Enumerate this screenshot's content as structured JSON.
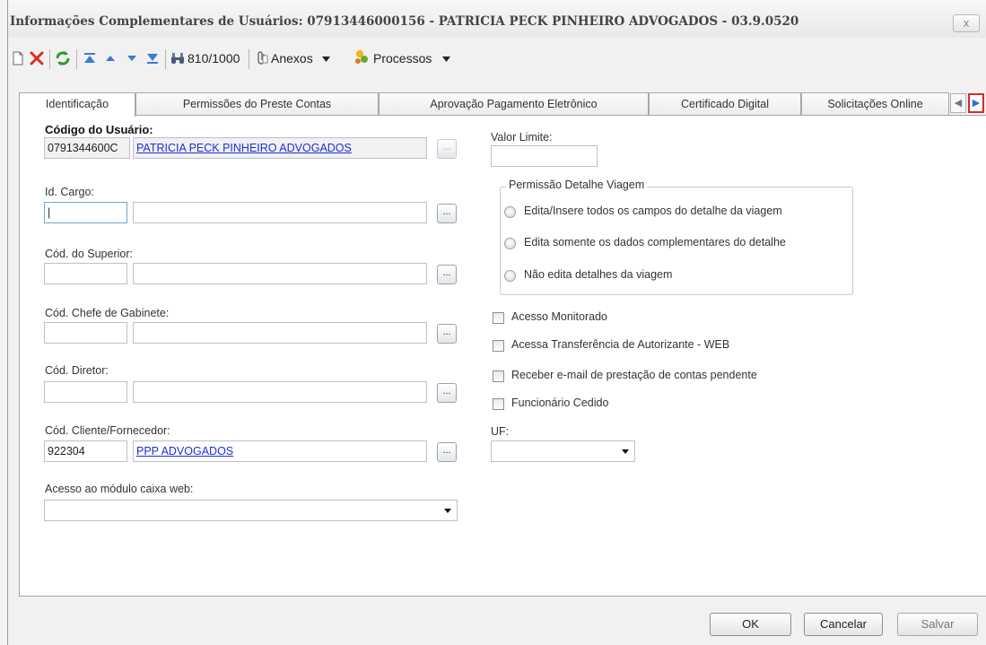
{
  "window": {
    "title": "Informações Complementares de Usuários: 07913446000156 - PATRICIA PECK PINHEIRO ADVOGADOS - 03.9.0520",
    "close_label": "x"
  },
  "toolbar": {
    "record_counter": "810/1000",
    "attachments_label": "Anexos",
    "processes_label": "Processos",
    "icons": [
      "new-document-icon",
      "delete-icon",
      "refresh-icon",
      "first-record-icon",
      "previous-record-icon",
      "next-record-icon",
      "last-record-icon",
      "binoculars-icon",
      "paperclip-icon",
      "processes-icon"
    ]
  },
  "tabs": [
    {
      "label": "Identificação",
      "active": true
    },
    {
      "label": "Permissões do Preste Contas",
      "active": false
    },
    {
      "label": "Aprovação Pagamento Eletrônico",
      "active": false
    },
    {
      "label": "Certificado Digital",
      "active": false
    },
    {
      "label": "Solicitações Online",
      "active": false
    }
  ],
  "form": {
    "user_code_label": "Código do Usuário:",
    "user_code_value": "0791344600C",
    "user_name_value": "PATRICIA PECK PINHEIRO ADVOGADOS",
    "cargo_label": "Id. Cargo:",
    "cargo_value": "|",
    "superior_label": "Cód. do Superior:",
    "chefe_label": "Cód. Chefe de Gabinete:",
    "diretor_label": "Cód. Diretor:",
    "cliente_label": "Cód. Cliente/Fornecedor:",
    "cliente_code_value": "922304",
    "cliente_name_value": "PPP ADVOGADOS",
    "caixa_label": "Acesso ao módulo caixa web:",
    "caixa_value": "",
    "lookup_button_label": "...",
    "valor_limite_label": "Valor Limite:",
    "valor_limite_value": "",
    "viagem_group_title": "Permissão Detalhe Viagem",
    "viagem_options": [
      "Edita/Insere todos os campos do detalhe da viagem",
      "Edita somente os dados complementares do detalhe",
      "Não edita detalhes da viagem"
    ],
    "checkboxes": [
      {
        "label": "Acesso Monitorado",
        "checked": false
      },
      {
        "label": "Acessa Transferência de Autorizante - WEB",
        "checked": false
      },
      {
        "label": "Receber e-mail de prestação de contas pendente",
        "checked": false
      },
      {
        "label": "Funcionário Cedido",
        "checked": false
      }
    ],
    "uf_label": "UF:",
    "uf_value": ""
  },
  "buttons": {
    "ok": "OK",
    "cancel": "Cancelar",
    "save": "Salvar"
  }
}
